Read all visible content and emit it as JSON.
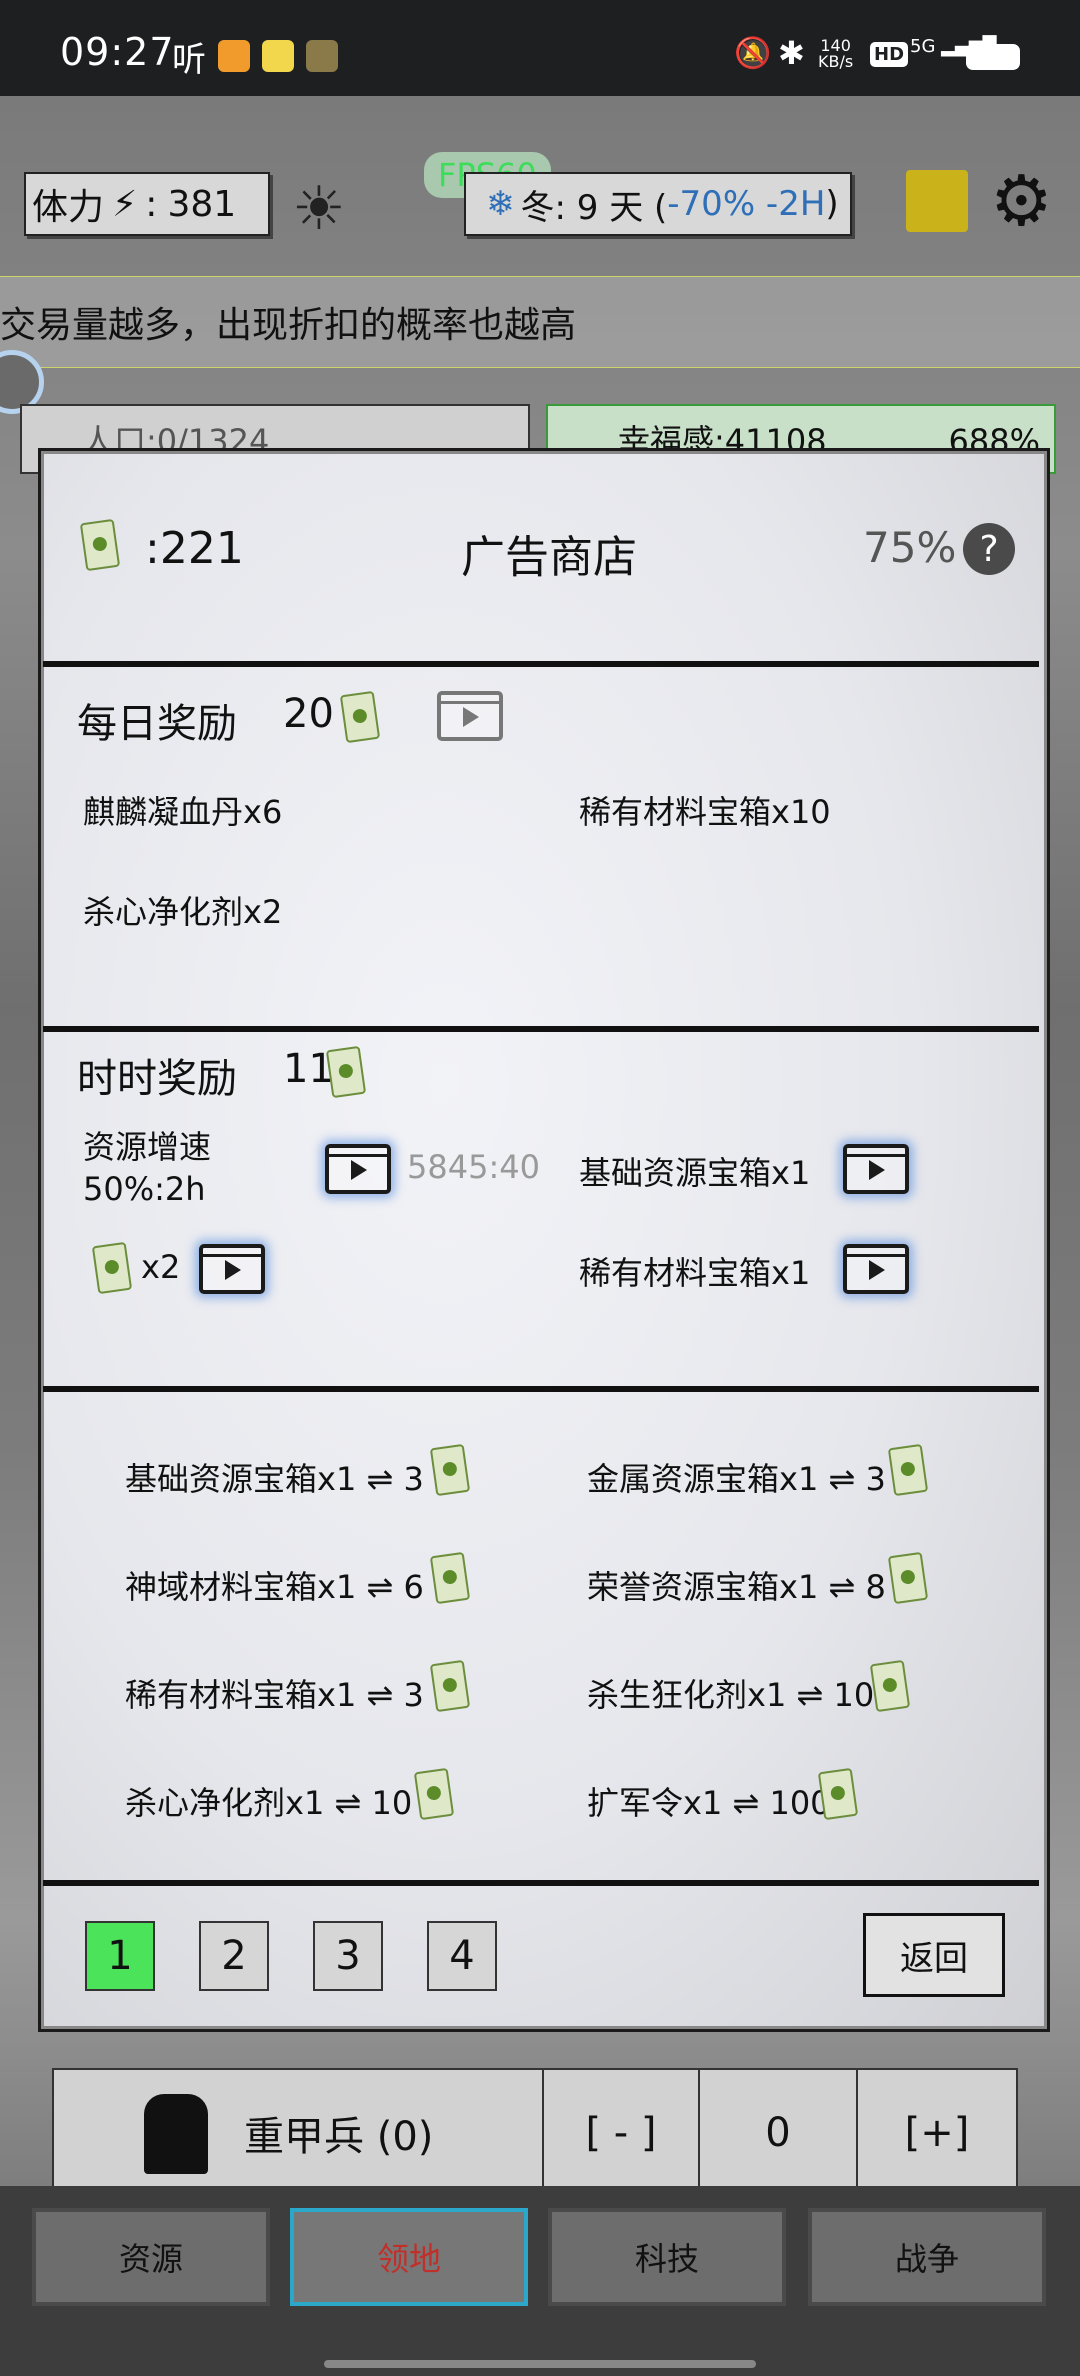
{
  "status_bar": {
    "time": "09:27",
    "carrier": "听",
    "net_speed_value": "140",
    "net_speed_unit": "KB/s",
    "hd": "HD",
    "net": "5G"
  },
  "header": {
    "stamina_label": "体力",
    "stamina_sep": ":",
    "stamina_value": "381",
    "fps": "FPS60",
    "season": "冬: 9 天 (",
    "season_mod": "-70% -2H",
    "season_close": ")"
  },
  "ticker": "交易量越多，出现折扣的概率也越高",
  "behind": {
    "population": "人口:0/1324",
    "happiness": "幸福感:41108",
    "happiness_pct": "688%"
  },
  "modal": {
    "currency": ":221",
    "title": "广告商店",
    "percent": "75%",
    "help": "?",
    "daily": {
      "title": "每日奖励",
      "count": "20",
      "items": [
        "麒麟凝血丹x6",
        "稀有材料宝箱x10",
        "杀心净化剂x2"
      ]
    },
    "hourly": {
      "title": "时时奖励",
      "count": "11",
      "boost_line1": "资源增速",
      "boost_line2": "50%:2h",
      "timer": "5845:40",
      "basic_box": "基础资源宝箱x1",
      "money_x2": "x2",
      "rare_box": "稀有材料宝箱x1"
    },
    "exchange": [
      {
        "left": "基础资源宝箱x1 ⇌ 3",
        "right": "金属资源宝箱x1 ⇌ 3"
      },
      {
        "left": "神域材料宝箱x1 ⇌ 6",
        "right": "荣誉资源宝箱x1 ⇌ 8"
      },
      {
        "left": "稀有材料宝箱x1 ⇌ 3",
        "right": "杀生狂化剂x1 ⇌ 10"
      },
      {
        "left": "杀心净化剂x1 ⇌ 10",
        "right": "扩军令x1 ⇌ 100"
      }
    ],
    "pages": [
      "1",
      "2",
      "3",
      "4"
    ],
    "active_page": "1",
    "back": "返回"
  },
  "army_row": {
    "unit": "重甲兵 (0)",
    "minus": "[ - ]",
    "count": "0",
    "plus": "[+]"
  },
  "nav": {
    "tabs": [
      "资源",
      "领地",
      "科技",
      "战争"
    ],
    "active": "领地"
  },
  "colors": {
    "active_page": "#4be35a",
    "fps": "#3ddc5a",
    "season_mod": "#2f6fb8",
    "nav_active_border": "#2aa7c9"
  }
}
